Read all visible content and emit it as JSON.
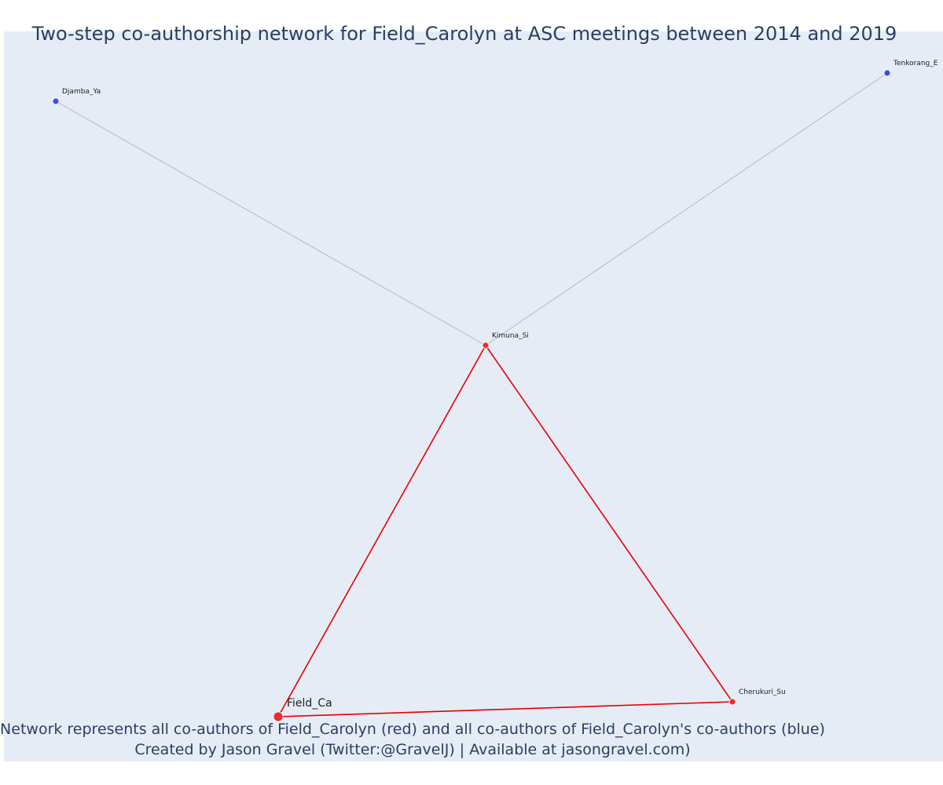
{
  "title": "Two-step co-authorship network for Field_Carolyn at ASC meetings between 2014 and 2019",
  "caption_line1": "Network represents all co-authors of Field_Carolyn (red) and all co-authors of Field_Carolyn's co-authors (blue)",
  "caption_line2": "Created by Jason Gravel (Twitter:@GravelJ) | Available at jasongravel.com)",
  "colors": {
    "background": "#e5ecf6",
    "direct_coauthor": "#ef2b2b",
    "second_step_coauthor": "#3b4ee6",
    "direct_edge": "#e60000",
    "second_step_edge": "#b3b8c8",
    "text": "#2a3f5f"
  },
  "nodes": [
    {
      "id": "Field_Carolyn",
      "label": "Field_Ca",
      "group": "focal"
    },
    {
      "id": "Kimuna_Si",
      "label": "Kimuna_Si",
      "group": "direct"
    },
    {
      "id": "Cherukuri_Su",
      "label": "Cherukuri_Su",
      "group": "direct"
    },
    {
      "id": "Djamba_Ya",
      "label": "Djamba_Ya",
      "group": "second"
    },
    {
      "id": "Tenkorang_E",
      "label": "Tenkorang_E",
      "group": "second"
    }
  ],
  "edges": [
    {
      "source": "Field_Carolyn",
      "target": "Kimuna_Si",
      "type": "direct"
    },
    {
      "source": "Field_Carolyn",
      "target": "Cherukuri_Su",
      "type": "direct"
    },
    {
      "source": "Kimuna_Si",
      "target": "Cherukuri_Su",
      "type": "direct"
    },
    {
      "source": "Kimuna_Si",
      "target": "Djamba_Ya",
      "type": "second"
    },
    {
      "source": "Kimuna_Si",
      "target": "Tenkorang_E",
      "type": "second"
    }
  ]
}
